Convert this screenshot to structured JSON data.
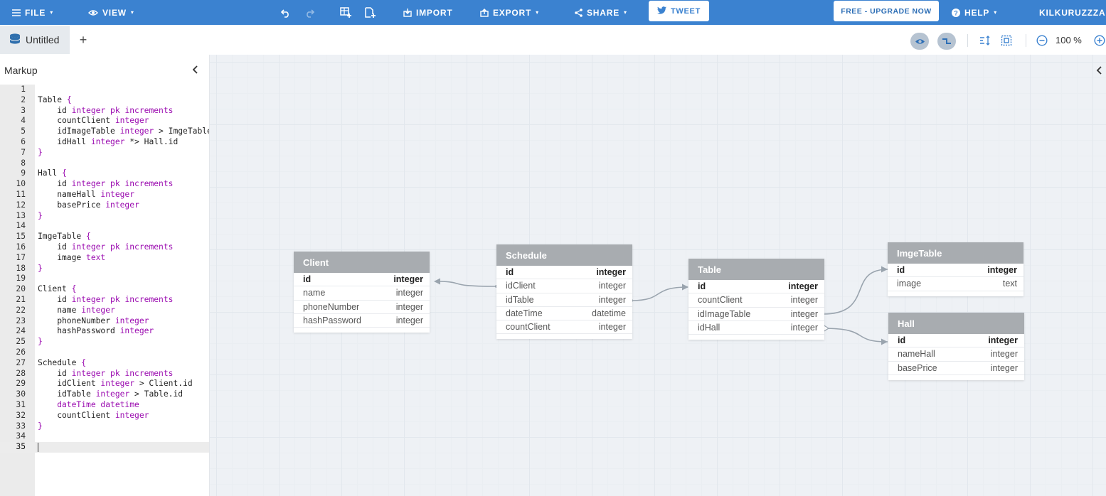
{
  "topbar": {
    "file": "FILE",
    "view": "VIEW",
    "import": "IMPORT",
    "export": "EXPORT",
    "share": "SHARE",
    "tweet": "TWEET",
    "upgrade": "FREE - UPGRADE NOW",
    "help": "HELP",
    "user": "KILKURUZZZA"
  },
  "tabs": {
    "active_label": "Untitled",
    "add": "+"
  },
  "toolbar": {
    "zoom": "100 %"
  },
  "markup": {
    "title": "Markup",
    "lines": [
      "",
      "Table {",
      "    id integer pk increments",
      "    countClient integer",
      "    idImageTable integer > ImgeTable.id",
      "    idHall integer *> Hall.id",
      "}",
      "",
      "Hall {",
      "    id integer pk increments",
      "    nameHall integer",
      "    basePrice integer",
      "}",
      "",
      "ImgeTable {",
      "    id integer pk increments",
      "    image text",
      "}",
      "",
      "Client {",
      "    id integer pk increments",
      "    name integer",
      "    phoneNumber integer",
      "    hashPassword integer",
      "}",
      "",
      "Schedule {",
      "    id integer pk increments",
      "    idClient integer > Client.id",
      "    idTable integer > Table.id",
      "    dateTime datetime",
      "    countClient integer",
      "}",
      "",
      ""
    ]
  },
  "diagram": {
    "tables": [
      {
        "name": "Client",
        "fields": [
          {
            "name": "id",
            "type": "integer",
            "pk": true
          },
          {
            "name": "name",
            "type": "integer"
          },
          {
            "name": "phoneNumber",
            "type": "integer"
          },
          {
            "name": "hashPassword",
            "type": "integer"
          }
        ]
      },
      {
        "name": "Schedule",
        "fields": [
          {
            "name": "id",
            "type": "integer",
            "pk": true
          },
          {
            "name": "idClient",
            "type": "integer"
          },
          {
            "name": "idTable",
            "type": "integer"
          },
          {
            "name": "dateTime",
            "type": "datetime"
          },
          {
            "name": "countClient",
            "type": "integer"
          }
        ]
      },
      {
        "name": "Table",
        "fields": [
          {
            "name": "id",
            "type": "integer",
            "pk": true
          },
          {
            "name": "countClient",
            "type": "integer"
          },
          {
            "name": "idImageTable",
            "type": "integer"
          },
          {
            "name": "idHall",
            "type": "integer"
          }
        ]
      },
      {
        "name": "ImgeTable",
        "fields": [
          {
            "name": "id",
            "type": "integer",
            "pk": true
          },
          {
            "name": "image",
            "type": "text"
          }
        ]
      },
      {
        "name": "Hall",
        "fields": [
          {
            "name": "id",
            "type": "integer",
            "pk": true
          },
          {
            "name": "nameHall",
            "type": "integer"
          },
          {
            "name": "basePrice",
            "type": "integer"
          }
        ]
      }
    ]
  },
  "colors": {
    "accent": "#3b82d0",
    "table_header": "#a8acb0",
    "keyword": "#9b0cb0"
  }
}
